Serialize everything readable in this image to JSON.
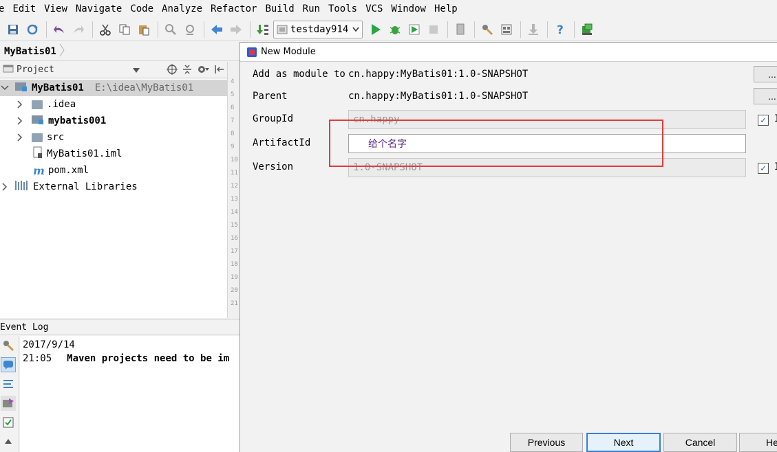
{
  "menu": {
    "items": [
      "File",
      "Edit",
      "View",
      "Navigate",
      "Code",
      "Analyze",
      "Refactor",
      "Build",
      "Run",
      "Tools",
      "VCS",
      "Window",
      "Help"
    ],
    "shown_first": "e"
  },
  "toolbar": {
    "run_config_label": "testday914",
    "icons": [
      "save-all-icon",
      "sync-icon",
      "undo-icon",
      "redo-icon",
      "cut-icon",
      "copy-icon",
      "paste-icon",
      "find-icon",
      "replace-icon",
      "back-icon",
      "forward-icon",
      "make-project-icon",
      "run-icon",
      "debug-icon",
      "coverage-icon",
      "stop-icon",
      "device-icon",
      "settings-icon",
      "project-structure-icon",
      "vcs-update-icon",
      "help-icon",
      "sdk-manager-icon"
    ]
  },
  "breadcrumb": {
    "root": "MyBatis01"
  },
  "project_panel": {
    "header_label": "Project",
    "tree": [
      {
        "label": "MyBatis01",
        "path": "E:\\idea\\MyBatis01",
        "bold": true
      },
      {
        "label": ".idea"
      },
      {
        "label": "mybatis001",
        "bold": true
      },
      {
        "label": "src"
      },
      {
        "label": "MyBatis01.iml"
      },
      {
        "label": "pom.xml"
      },
      {
        "label": "External Libraries"
      }
    ]
  },
  "gutter_lines": [
    "4",
    "5",
    "6",
    "7",
    "8",
    "9",
    "10",
    "11",
    "12",
    "13",
    "14",
    "15",
    "16",
    "17",
    "18",
    "19",
    "20",
    "21"
  ],
  "event_log": {
    "header": "Event Log",
    "date": "2017/9/14",
    "time": "21:05",
    "message": "Maven projects need to be im"
  },
  "dialog": {
    "title": "New Module",
    "add_as_module_label": "Add as module to",
    "add_as_module_value": "cn.happy:MyBatis01:1.0-SNAPSHOT",
    "parent_label": "Parent",
    "parent_value": "cn.happy:MyBatis01:1.0-SNAPSHOT",
    "group_id_label": "GroupId",
    "group_id_value": "cn.happy",
    "artifact_id_label": "ArtifactId",
    "artifact_id_value": "给个名字",
    "version_label": "Version",
    "version_value": "1.0-SNAPSHOT",
    "dots_label": "...",
    "inherit_label": "I",
    "buttons": {
      "previous": "Previous",
      "next": "Next",
      "cancel": "Cancel",
      "help": "He"
    },
    "accent_color": "#e23b3b"
  }
}
